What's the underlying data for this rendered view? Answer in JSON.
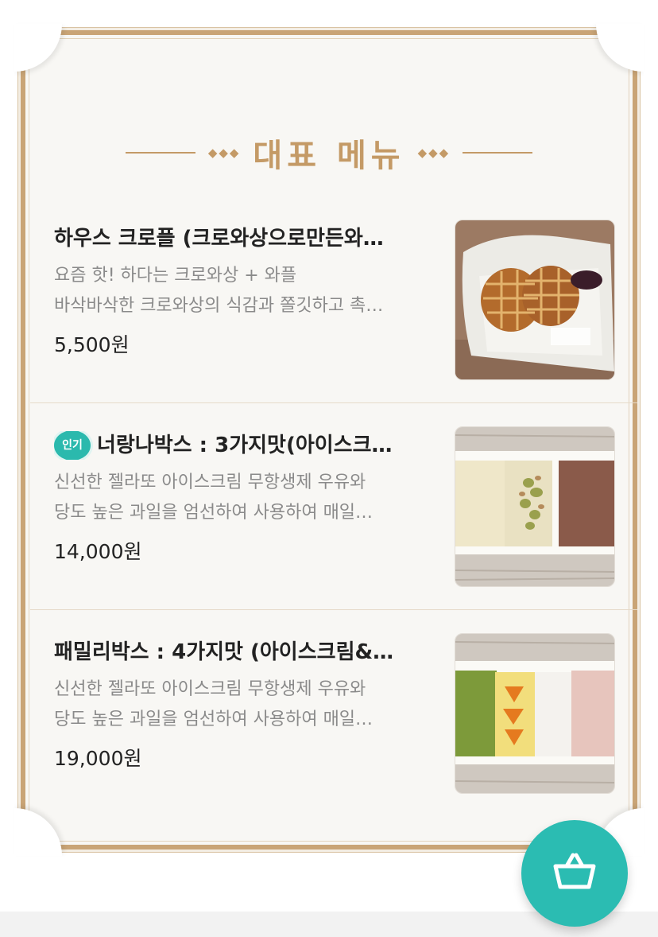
{
  "section": {
    "title": "대표 메뉴"
  },
  "menu": [
    {
      "name": "하우스 크로플 (크로와상으로만든와…",
      "badge": "",
      "desc": [
        "요즘 핫! 하다는 크로와상 + 와플",
        "바삭바삭한 크로와상의 식감과 쫄깃하고 촉…"
      ],
      "price": "5,500원",
      "image_icon": "croffle-photo"
    },
    {
      "name": "너랑나박스 : 3가지맛(아이스크…",
      "badge": "인기",
      "desc": [
        "신선한 젤라또 아이스크림 무항생제 우유와",
        "당도 높은 과일을 엄선하여 사용하여 매일…"
      ],
      "price": "14,000원",
      "image_icon": "gelato-box-3-photo"
    },
    {
      "name": "패밀리박스 : 4가지맛 (아이스크림&…",
      "badge": "",
      "desc": [
        "신선한 젤라또 아이스크림 무항생제 우유와",
        "당도 높은 과일을 엄선하여 사용하여 매일…"
      ],
      "price": "19,000원",
      "image_icon": "gelato-box-4-photo"
    }
  ],
  "cart_button": {
    "icon": "basket-icon",
    "color": "#2bbcb2"
  },
  "colors": {
    "accent": "#c49a66",
    "badge": "#2bb9ad"
  }
}
